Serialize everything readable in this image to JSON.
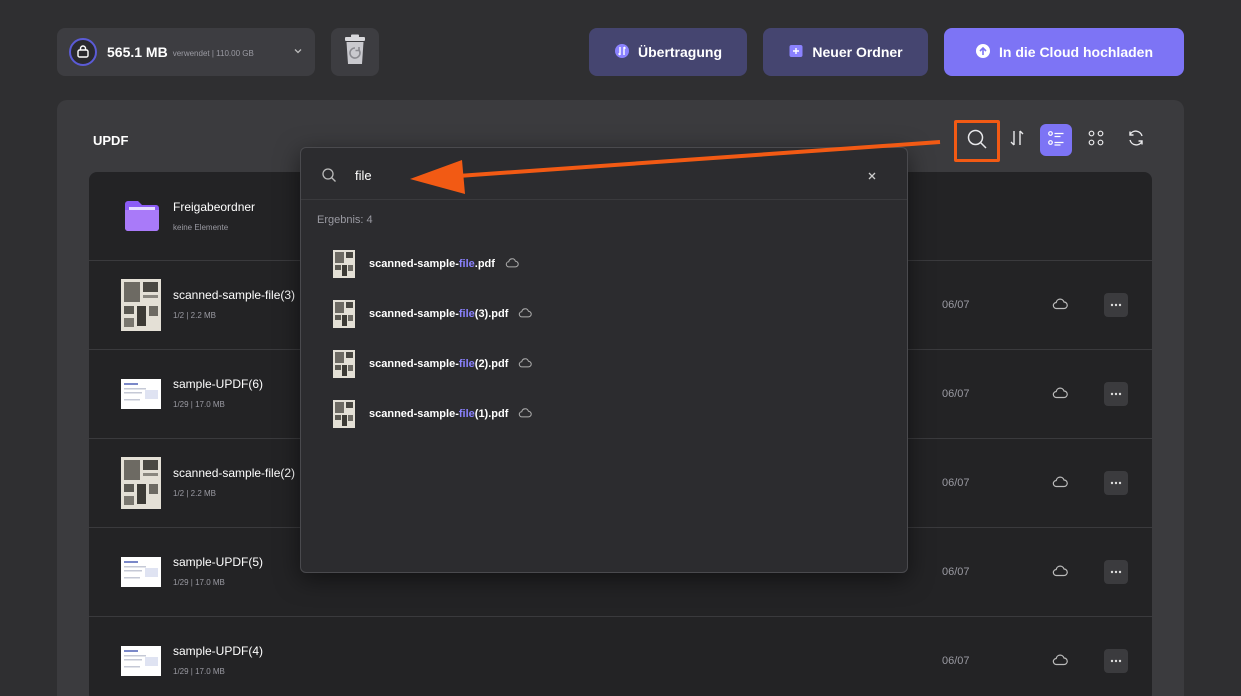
{
  "storage": {
    "used": "565.1 MB",
    "meta": "verwendet | 110.00 GB"
  },
  "toolbar": {
    "transfer_label": "Übertragung",
    "new_folder_label": "Neuer Ordner",
    "upload_label": "In die Cloud hochladen"
  },
  "panel": {
    "title": "UPDF"
  },
  "colors": {
    "accent": "#7d74f5",
    "highlight": "#f25a14",
    "background": "#2f2f31"
  },
  "files": [
    {
      "name": "Freigabeordner",
      "meta": "keine Elemente",
      "type": "folder",
      "date": ""
    },
    {
      "name": "scanned-sample-file(3)",
      "meta": "1/2 | 2.2 MB",
      "type": "scan",
      "date": "06/07"
    },
    {
      "name": "sample-UPDF(6)",
      "meta": "1/29 | 17.0 MB",
      "type": "doc",
      "date": "06/07"
    },
    {
      "name": "scanned-sample-file(2)",
      "meta": "1/2 | 2.2 MB",
      "type": "scan",
      "date": "06/07"
    },
    {
      "name": "sample-UPDF(5)",
      "meta": "1/29 | 17.0 MB",
      "type": "doc",
      "date": "06/07"
    },
    {
      "name": "sample-UPDF(4)",
      "meta": "1/29 | 17.0 MB",
      "type": "doc",
      "date": "06/07"
    }
  ],
  "search": {
    "value": "file",
    "result_label": "Ergebnis: 4",
    "results": [
      {
        "prefix": "scanned-sample-",
        "match": "file",
        "suffix": ".pdf"
      },
      {
        "prefix": "scanned-sample-",
        "match": "file",
        "suffix": "(3).pdf"
      },
      {
        "prefix": "scanned-sample-",
        "match": "file",
        "suffix": "(2).pdf"
      },
      {
        "prefix": "scanned-sample-",
        "match": "file",
        "suffix": "(1).pdf"
      }
    ]
  }
}
